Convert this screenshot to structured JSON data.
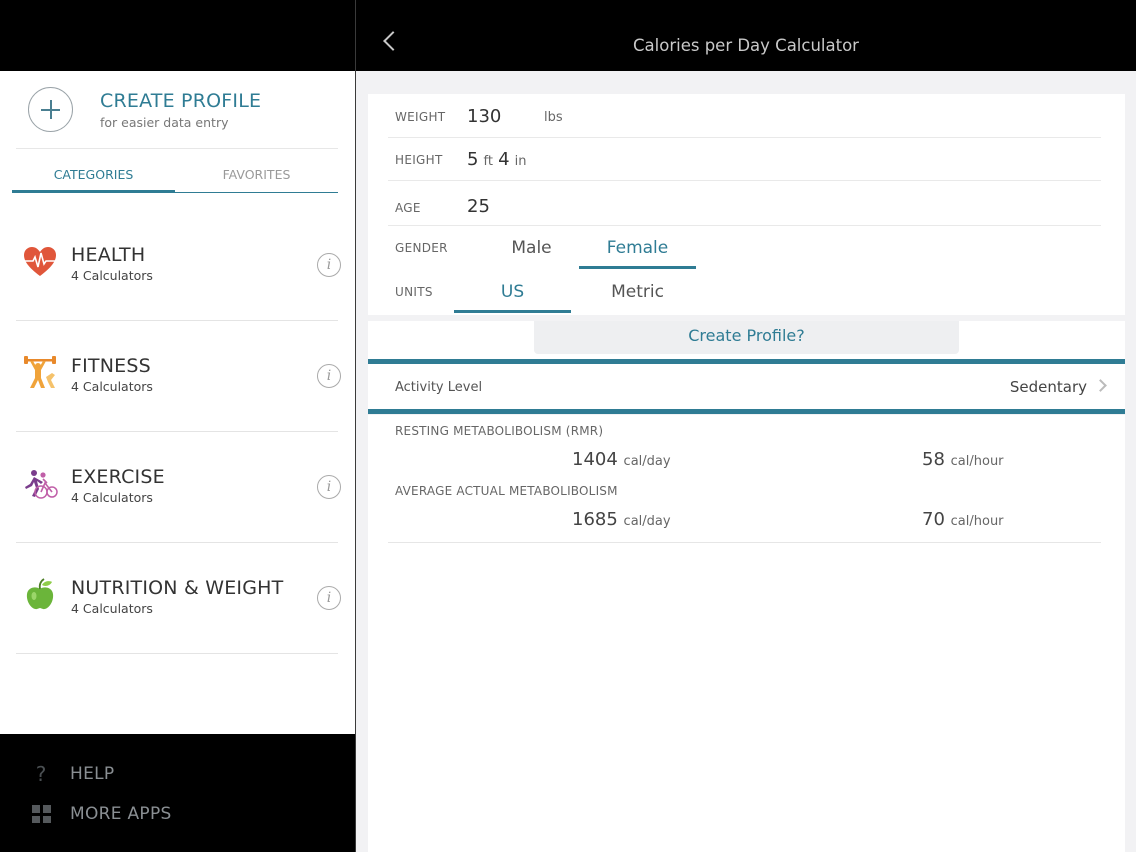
{
  "app": {
    "title": "Calories per Day Calculator"
  },
  "sidebar": {
    "profile": {
      "title": "CREATE PROFILE",
      "subtitle": "for easier data entry"
    },
    "tabs": [
      {
        "label": "CATEGORIES",
        "active": true
      },
      {
        "label": "FAVORITES",
        "active": false
      }
    ],
    "categories": [
      {
        "name": "HEALTH",
        "count": "4 Calculators",
        "icon": "heart-icon"
      },
      {
        "name": "FITNESS",
        "count": "4 Calculators",
        "icon": "weightlifter-icon"
      },
      {
        "name": "EXERCISE",
        "count": "4 Calculators",
        "icon": "cyclist-icon"
      },
      {
        "name": "NUTRITION & WEIGHT",
        "count": "4 Calculators",
        "icon": "apple-icon"
      }
    ],
    "bottom": {
      "help": "HELP",
      "more_apps": "MORE APPS"
    }
  },
  "form": {
    "weight": {
      "label": "WEIGHT",
      "value": "130",
      "unit": "lbs"
    },
    "height": {
      "label": "HEIGHT",
      "feet": "5",
      "feet_unit": "ft",
      "inches": "4",
      "inches_unit": "in"
    },
    "age": {
      "label": "AGE",
      "value": "25"
    },
    "gender": {
      "label": "GENDER",
      "options": [
        "Male",
        "Female"
      ],
      "selected": "Female"
    },
    "units": {
      "label": "UNITS",
      "options": [
        "US",
        "Metric"
      ],
      "selected": "US"
    }
  },
  "create_profile_prompt": "Create Profile?",
  "activity": {
    "label": "Activity Level",
    "value": "Sedentary"
  },
  "results": {
    "rmr": {
      "title": "RESTING METABOLIBOLISM (RMR)",
      "per_day": "1404",
      "per_day_unit": "cal/day",
      "per_hour": "58",
      "per_hour_unit": "cal/hour"
    },
    "aam": {
      "title": "AVERAGE ACTUAL METABOLIBOLISM",
      "per_day": "1685",
      "per_day_unit": "cal/day",
      "per_hour": "70",
      "per_hour_unit": "cal/hour"
    }
  },
  "colors": {
    "accent": "#2f7c94",
    "bar": "#000000"
  }
}
